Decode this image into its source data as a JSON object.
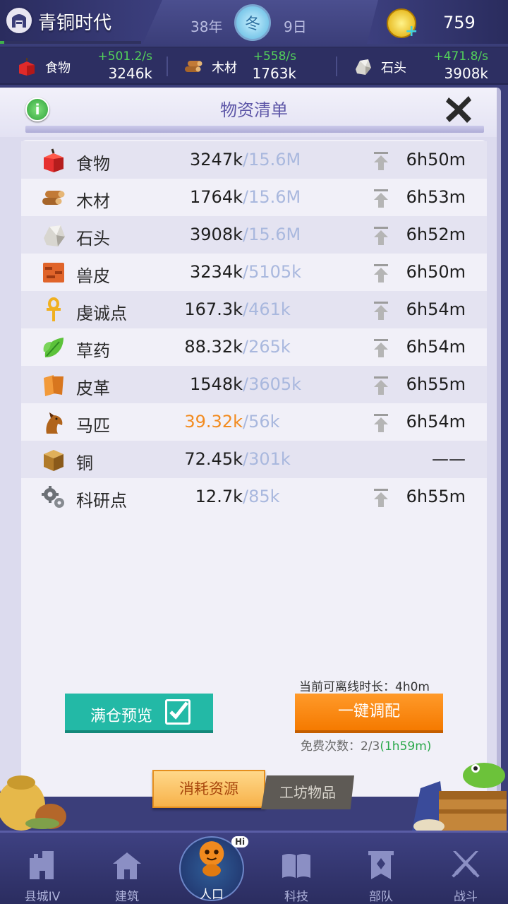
{
  "header": {
    "era_title": "青铜时代",
    "era_progress_percent": 3,
    "year": "38年",
    "season": "冬",
    "day": "9日",
    "gold": "759"
  },
  "resources_bar": [
    {
      "name": "食物",
      "rate": "+501.2/s",
      "amount": "3246k",
      "icon": "food-apple-icon"
    },
    {
      "name": "木材",
      "rate": "+558/s",
      "amount": "1763k",
      "icon": "wood-logs-icon"
    },
    {
      "name": "石头",
      "rate": "+471.8/s",
      "amount": "3908k",
      "icon": "stone-icon"
    }
  ],
  "panel": {
    "title": "物资清单",
    "info_label": "i"
  },
  "materials": [
    {
      "name": "食物",
      "current": "3247k",
      "cap": "/15.6M",
      "time": "6h50m",
      "icon": "food-apple-icon"
    },
    {
      "name": "木材",
      "current": "1764k",
      "cap": "/15.6M",
      "time": "6h53m",
      "icon": "wood-logs-icon"
    },
    {
      "name": "石头",
      "current": "3908k",
      "cap": "/15.6M",
      "time": "6h52m",
      "icon": "stone-icon"
    },
    {
      "name": "兽皮",
      "current": "3234k",
      "cap": "/5105k",
      "time": "6h50m",
      "icon": "hide-icon"
    },
    {
      "name": "虔诚点",
      "current": "167.3k",
      "cap": "/461k",
      "time": "6h54m",
      "icon": "ankh-icon"
    },
    {
      "name": "草药",
      "current": "88.32k",
      "cap": "/265k",
      "time": "6h54m",
      "icon": "herb-leaf-icon"
    },
    {
      "name": "皮革",
      "current": "1548k",
      "cap": "/3605k",
      "time": "6h55m",
      "icon": "leather-icon"
    },
    {
      "name": "马匹",
      "current": "39.32k",
      "cap": "/56k",
      "time": "6h54m",
      "icon": "horse-icon",
      "warn": true
    },
    {
      "name": "铜",
      "current": "72.45k",
      "cap": "/301k",
      "time": "——",
      "icon": "copper-block-icon"
    },
    {
      "name": "科研点",
      "current": "12.7k",
      "cap": "/85k",
      "time": "6h55m",
      "icon": "gears-icon"
    }
  ],
  "actions": {
    "preview_label": "满仓预览",
    "offline_text": "当前可离线时长：4h0m",
    "dispatch_label": "一键调配",
    "free_prefix": "免费次数：2/3",
    "free_timer": "(1h59m)"
  },
  "tabs": {
    "consume": "消耗资源",
    "workshop": "工坊物品"
  },
  "nav": [
    {
      "label": "县城IV",
      "icon": "castle-icon"
    },
    {
      "label": "建筑",
      "icon": "house-icon"
    },
    {
      "label": "人口",
      "icon": "villager-icon",
      "active": true,
      "bubble": "Hi"
    },
    {
      "label": "科技",
      "icon": "book-icon"
    },
    {
      "label": "部队",
      "icon": "banner-icon"
    },
    {
      "label": "战斗",
      "icon": "crossed-swords-icon"
    }
  ],
  "colors": {
    "accent_teal": "#23b9a6",
    "accent_orange": "#f57a00",
    "warn_orange": "#f28b1f",
    "rate_green": "#53d25a",
    "cap_blue": "#a9b8de"
  }
}
